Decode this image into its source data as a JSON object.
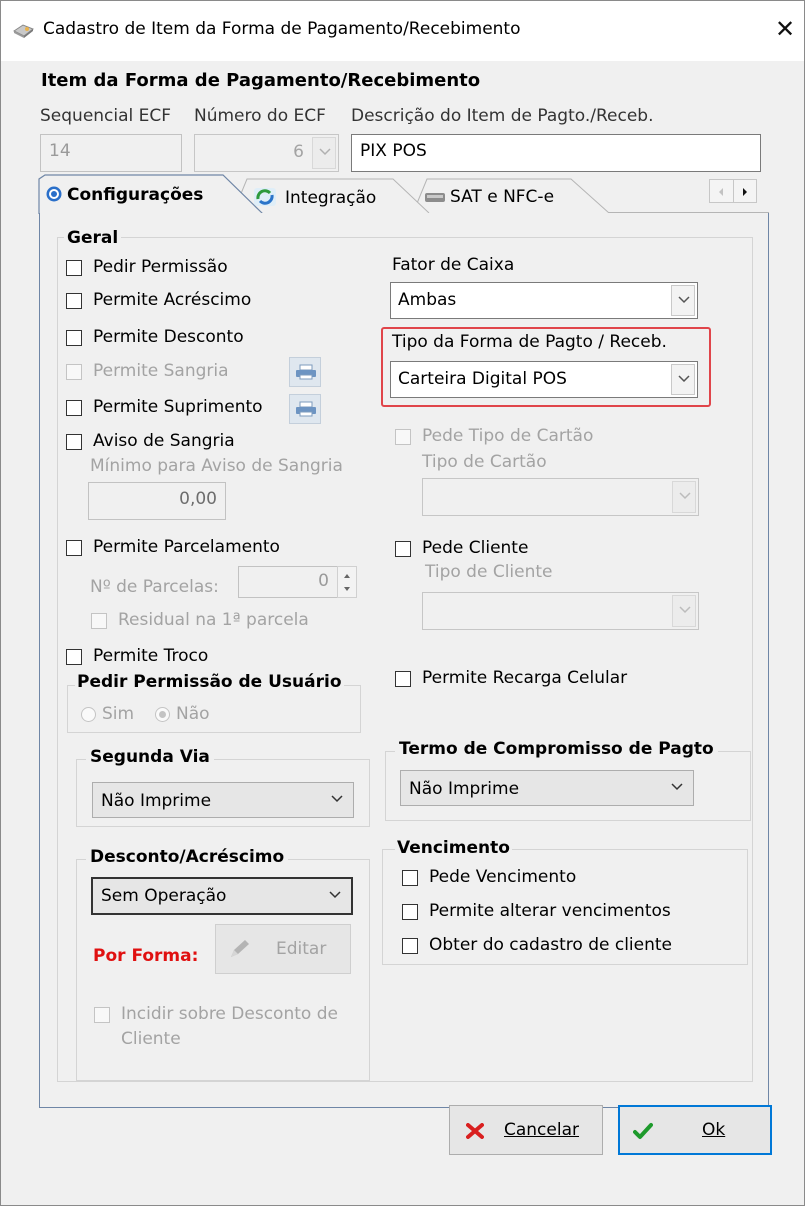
{
  "window": {
    "title": "Cadastro de Item da Forma de Pagamento/Recebimento",
    "close_glyph": "✕"
  },
  "header": {
    "section_title": "Item da Forma de Pagamento/Recebimento",
    "sequencial_label": "Sequencial ECF",
    "sequencial_value": "14",
    "numero_label": "Número do ECF",
    "numero_value": "6",
    "descricao_label": "Descrição do Item de Pagto./Receb.",
    "descricao_value": "PIX POS"
  },
  "tabs": [
    {
      "label": "Configurações",
      "icon": "gear-icon",
      "active": true
    },
    {
      "label": "Integração",
      "icon": "sync-icon",
      "active": false
    },
    {
      "label": "SAT e NFC-e",
      "icon": "printer-icon",
      "active": false
    }
  ],
  "geral": {
    "title": "Geral",
    "pedir_permissao": "Pedir Permissão",
    "permite_acrescimo": "Permite Acréscimo",
    "permite_desconto": "Permite Desconto",
    "permite_sangria": "Permite Sangria",
    "permite_suprimento": "Permite Suprimento",
    "aviso_sangria": "Aviso de Sangria",
    "minimo_aviso_label": "Mínimo para Aviso de Sangria",
    "minimo_aviso_value": "0,00",
    "permite_parcelamento": "Permite Parcelamento",
    "num_parcelas_label": "Nº de Parcelas:",
    "num_parcelas_value": "0",
    "residual": "Residual na 1ª parcela",
    "permite_troco": "Permite Troco"
  },
  "pedir_permissao_usuario": {
    "title": "Pedir Permissão de Usuário",
    "sim": "Sim",
    "nao": "Não"
  },
  "right": {
    "fator_caixa_label": "Fator de Caixa",
    "fator_caixa_value": "Ambas",
    "tipo_forma_label": "Tipo da Forma de Pagto / Receb.",
    "tipo_forma_value": "Carteira Digital POS",
    "highlight_color": "#e0454a",
    "pede_tipo_cartao": "Pede Tipo de Cartão",
    "tipo_cartao_label": "Tipo de Cartão",
    "pede_cliente": "Pede Cliente",
    "tipo_cliente_label": "Tipo de Cliente",
    "permite_recarga": "Permite Recarga Celular"
  },
  "segunda_via": {
    "title": "Segunda Via",
    "value": "Não Imprime"
  },
  "termo": {
    "title": "Termo de Compromisso de Pagto",
    "value": "Não Imprime"
  },
  "desconto_acrescimo": {
    "title": "Desconto/Acréscimo",
    "value": "Sem Operação",
    "por_forma": "Por Forma:",
    "por_forma_color": "#e01010",
    "editar": "Editar",
    "incidir_line1": "Incidir sobre Desconto de",
    "incidir_line2": "Cliente"
  },
  "vencimento": {
    "title": "Vencimento",
    "pede_vencimento": "Pede Vencimento",
    "permite_alterar": "Permite alterar vencimentos",
    "obter_cadastro": "Obter do cadastro de cliente"
  },
  "footer": {
    "cancelar": "Cancelar",
    "ok": "Ok"
  }
}
